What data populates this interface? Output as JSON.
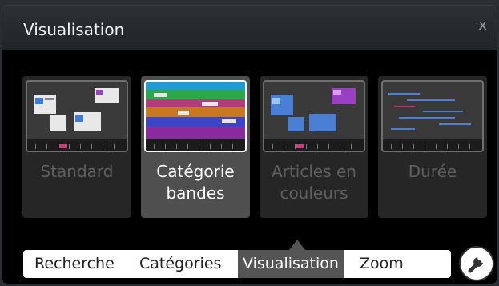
{
  "panel": {
    "title": "Visualisation",
    "close_label": "x"
  },
  "views": [
    {
      "label": "Standard",
      "selected": false,
      "icon": "standard-view-thumbnail"
    },
    {
      "label": "Catégorie bandes",
      "selected": true,
      "icon": "category-bands-thumbnail"
    },
    {
      "label": "Articles en couleurs",
      "selected": false,
      "icon": "colored-articles-thumbnail"
    },
    {
      "label": "Durée",
      "selected": false,
      "icon": "duration-view-thumbnail"
    }
  ],
  "tabs": [
    {
      "label": "Recherche",
      "active": false
    },
    {
      "label": "Catégories",
      "active": false
    },
    {
      "label": "Visualisation",
      "active": true
    },
    {
      "label": "Zoom",
      "active": false
    }
  ],
  "tools_icon": "wrench-icon",
  "colors": {
    "panel_bg": "#000000",
    "card_bg": "#262626",
    "card_selected_bg": "#4f4f4f",
    "tab_active_bg": "#555555",
    "band_colors": [
      "#1f9bd6",
      "#2ca84a",
      "#b33d7a",
      "#c8781e",
      "#3a45c8",
      "#8a2a9e"
    ]
  }
}
